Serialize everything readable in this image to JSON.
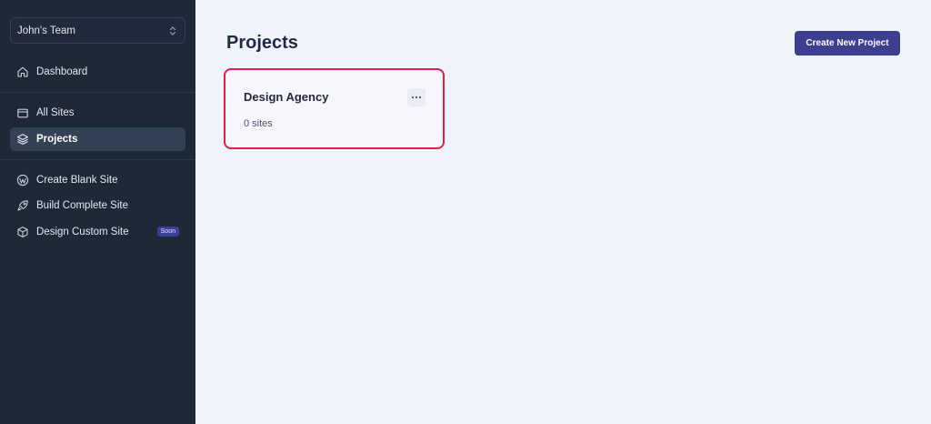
{
  "sidebar": {
    "team": {
      "name": "John's Team",
      "icon": "chevron-up-down-icon"
    },
    "items": [
      {
        "label": "Dashboard",
        "icon": "home-icon",
        "active": false
      },
      {
        "label": "All Sites",
        "icon": "folder-icon",
        "active": false
      },
      {
        "label": "Projects",
        "icon": "layers-icon",
        "active": true
      },
      {
        "label": "Create Blank Site",
        "icon": "wordpress-icon",
        "active": false
      },
      {
        "label": "Build Complete Site",
        "icon": "rocket-icon",
        "active": false
      },
      {
        "label": "Design Custom Site",
        "icon": "cube-icon",
        "active": false,
        "badge": "Soon"
      }
    ]
  },
  "main": {
    "title": "Projects",
    "create_button": "Create New Project",
    "projects": [
      {
        "name": "Design Agency",
        "meta": "0 sites",
        "menu_icon": "more-horizontal-icon"
      }
    ]
  },
  "colors": {
    "sidebar_bg": "#1e2837",
    "main_bg": "#eff3fa",
    "accent": "#3c3e8f",
    "highlight_border": "#e11d48"
  }
}
